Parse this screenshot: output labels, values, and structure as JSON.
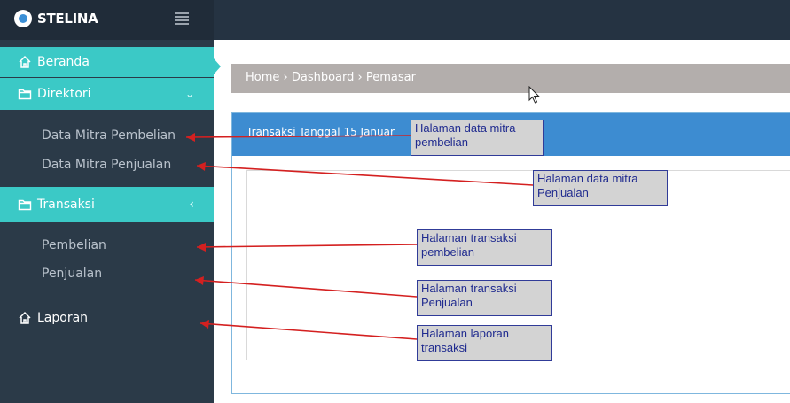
{
  "header": {
    "brand": "STELINA"
  },
  "sidebar": {
    "beranda": "Beranda",
    "direktori": "Direktori",
    "direktori_items": [
      "Data Mitra Pembelian",
      "Data Mitra Penjualan"
    ],
    "transaksi": "Transaksi",
    "transaksi_items": [
      "Pembelian",
      "Penjualan"
    ],
    "laporan": "Laporan"
  },
  "breadcrumb": "Home › Dashboard › Pemasar",
  "panel": {
    "title": "Transaksi Tanggal 15 Januar"
  },
  "annotations": [
    "Halaman data mitra pembelian",
    "Halaman data mitra Penjualan",
    "Halaman transaksi pembelian",
    "Halaman transaksi Penjualan",
    "Halaman laporan transaksi"
  ],
  "colors": {
    "accent": "#3bc9c6",
    "sidebar": "#2b3a48",
    "topbar": "#253342",
    "panel_header": "#3d8cd1",
    "arrow": "#d42020"
  }
}
